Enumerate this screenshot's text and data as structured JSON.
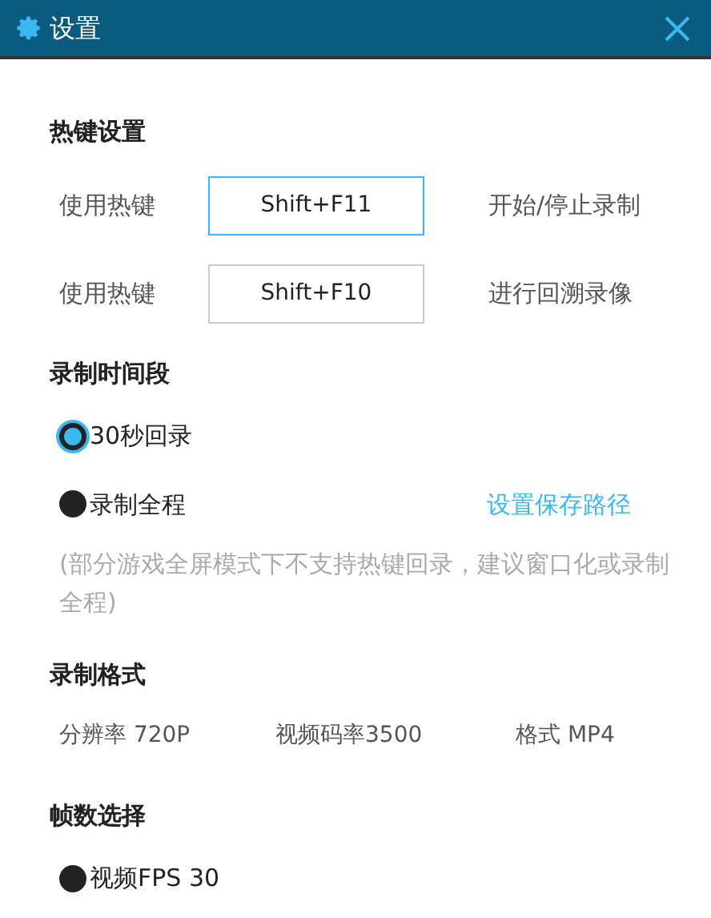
{
  "window": {
    "title": "设置"
  },
  "hotkey_section": {
    "heading": "热键设置",
    "rows": [
      {
        "label": "使用热键",
        "value": "Shift+F11",
        "focused": true,
        "action": "开始/停止录制"
      },
      {
        "label": "使用热键",
        "value": "Shift+F10",
        "focused": false,
        "action": "进行回溯录像"
      }
    ]
  },
  "record_section": {
    "heading": "录制时间段",
    "options": [
      {
        "label": "30秒回录",
        "selected": true
      },
      {
        "label": "录制全程",
        "selected": false
      }
    ],
    "link": "设置保存路径",
    "note": "(部分游戏全屏模式下不支持热键回录，建议窗口化或录制全程)"
  },
  "format_section": {
    "heading": "录制格式",
    "items": [
      "分辨率 720P",
      "视频码率3500",
      "格式 MP4"
    ]
  },
  "fps_section": {
    "heading": "帧数选择",
    "options": [
      {
        "label": "视频FPS 30",
        "selected": false
      }
    ]
  }
}
